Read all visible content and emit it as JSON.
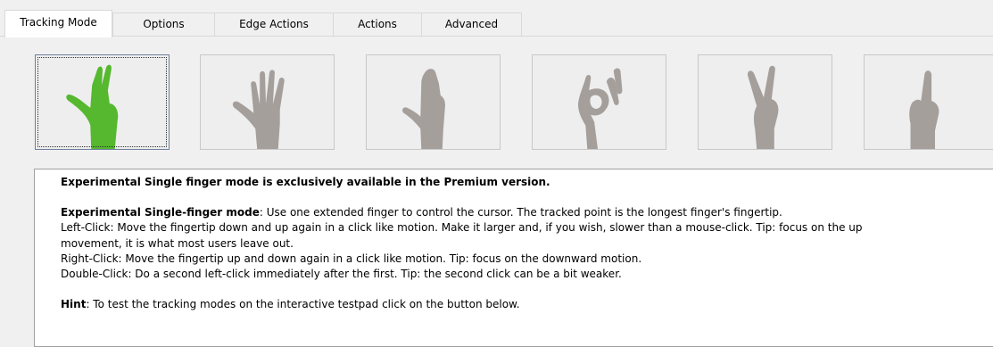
{
  "tabs": [
    {
      "label": "Tracking Mode",
      "active": true
    },
    {
      "label": "Options",
      "active": false
    },
    {
      "label": "Edge Actions",
      "active": false
    },
    {
      "label": "Actions",
      "active": false
    },
    {
      "label": "Advanced",
      "active": false
    }
  ],
  "gestures": [
    {
      "icon": "pointing-two-fingers-hand-icon",
      "selected": true,
      "color": "#55b82e"
    },
    {
      "icon": "open-hand-icon",
      "selected": false,
      "color": "#a59f9c"
    },
    {
      "icon": "closed-flat-hand-icon",
      "selected": false,
      "color": "#a59f9c"
    },
    {
      "icon": "ok-sign-hand-icon",
      "selected": false,
      "color": "#a59f9c"
    },
    {
      "icon": "victory-hand-icon",
      "selected": false,
      "color": "#a59f9c"
    },
    {
      "icon": "index-finger-hand-icon",
      "selected": false,
      "color": "#a59f9c"
    }
  ],
  "description": {
    "premium_notice": "Experimental Single finger mode is exclusively available in the Premium version.",
    "mode_title": "Experimental Single-finger mode",
    "mode_text": ": Use one extended finger to control the cursor. The tracked point is the longest finger's fingertip.",
    "left_click": "Left-Click: Move the fingertip down and up again in a click like motion. Make it larger and, if you wish, slower than a mouse-click. Tip: focus on the up",
    "left_click_cont": "movement, it is what most users leave out.",
    "right_click": "Right-Click: Move the fingertip up and down again in a click like motion. Tip: focus on the downward motion.",
    "double_click": "Double-Click: Do a second left-click immediately after the first. Tip: the second click can be a bit weaker.",
    "hint_label": "Hint",
    "hint_text": ": To test the tracking modes on the interactive testpad click on the button below."
  }
}
